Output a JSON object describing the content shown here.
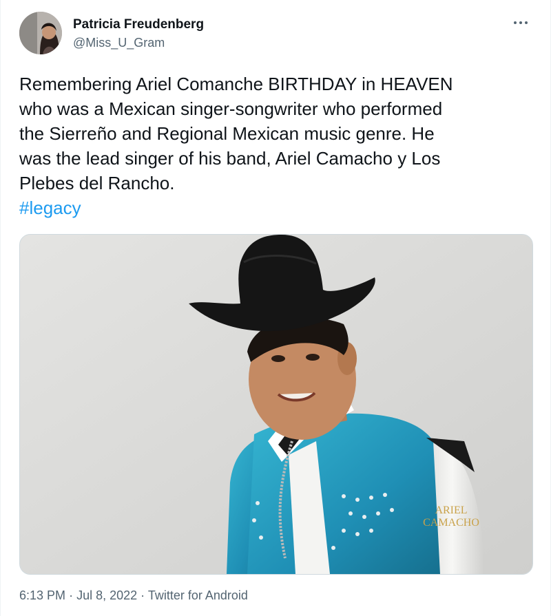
{
  "author": {
    "name": "Patricia Freudenberg",
    "handle": "@Miss_U_Gram",
    "avatar_icon": "profile-photo"
  },
  "more_icon": "ellipsis-icon",
  "tweet": {
    "text_lines": [
      "Remembering Ariel Comanche BIRTHDAY in HEAVEN",
      "who was a Mexican singer-songwriter who performed",
      "the Sierreño and Regional Mexican music genre. He",
      "was the lead singer of his band, Ariel Camacho y Los",
      "Plebes del Rancho."
    ],
    "hashtag": "#legacy"
  },
  "media": {
    "jacket_print_line1": "ARIEL",
    "jacket_print_line2": "CAMACHO"
  },
  "meta": {
    "time": "6:13 PM",
    "date": "Jul 8, 2022",
    "source": "Twitter for Android",
    "separator": "·"
  },
  "colors": {
    "link": "#1d9bf0",
    "secondary_text": "#536471",
    "jacket_teal": "#1f8fb5"
  }
}
